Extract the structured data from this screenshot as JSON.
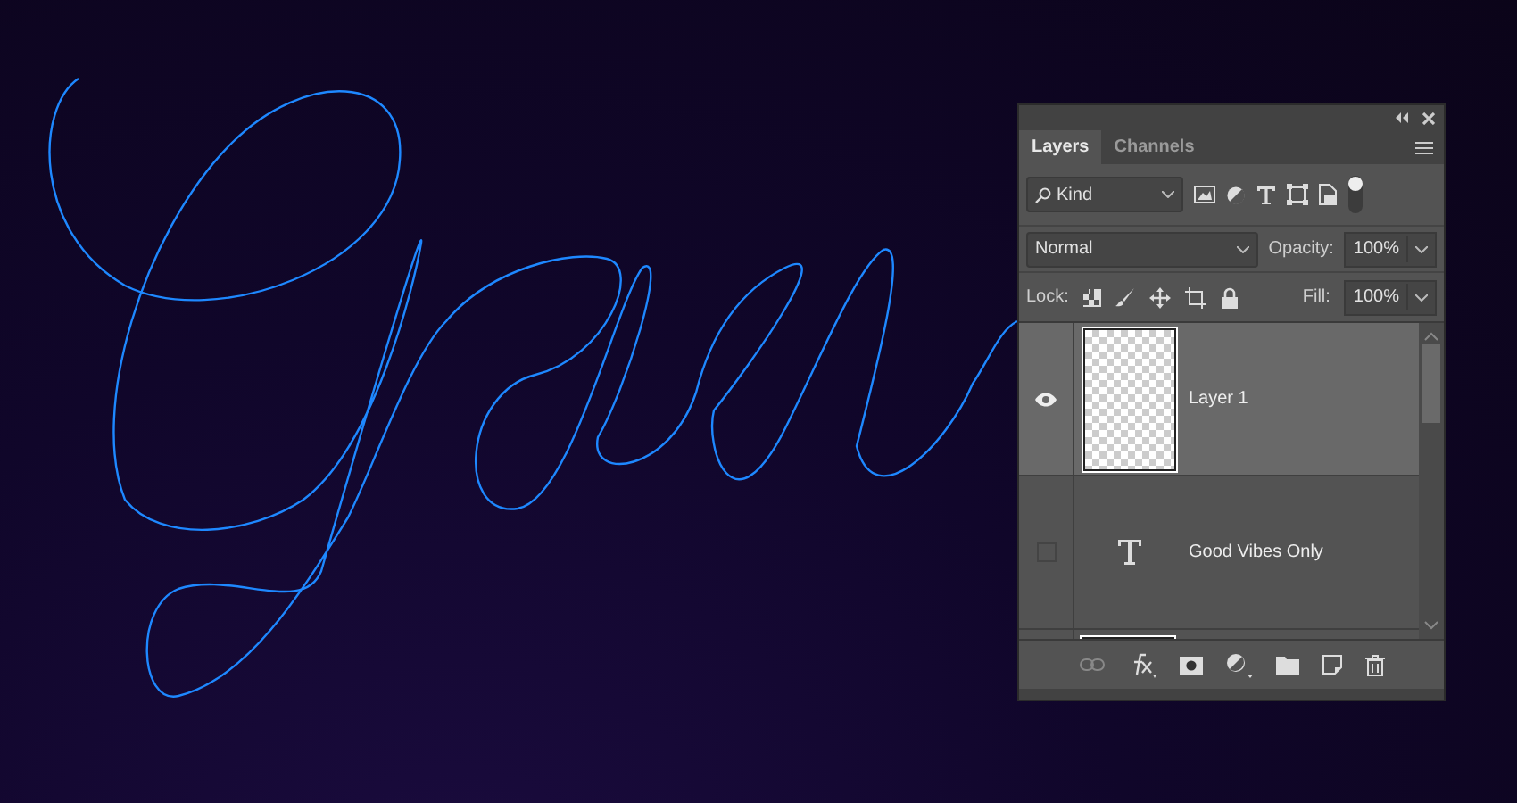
{
  "panel": {
    "tabs": [
      {
        "label": "Layers",
        "selected": true
      },
      {
        "label": "Channels",
        "selected": false
      }
    ],
    "filter": {
      "value": "Kind"
    },
    "blend_mode": {
      "value": "Normal"
    },
    "opacity": {
      "label": "Opacity:",
      "value": "100%"
    },
    "lock": {
      "label": "Lock:"
    },
    "fill": {
      "label": "Fill:",
      "value": "100%"
    },
    "layers": [
      {
        "name": "Layer 1",
        "kind": "raster",
        "visible": true,
        "selected": true
      },
      {
        "name": "Good Vibes Only",
        "kind": "text",
        "visible": false,
        "selected": false
      },
      {
        "kind": "raster"
      }
    ]
  }
}
